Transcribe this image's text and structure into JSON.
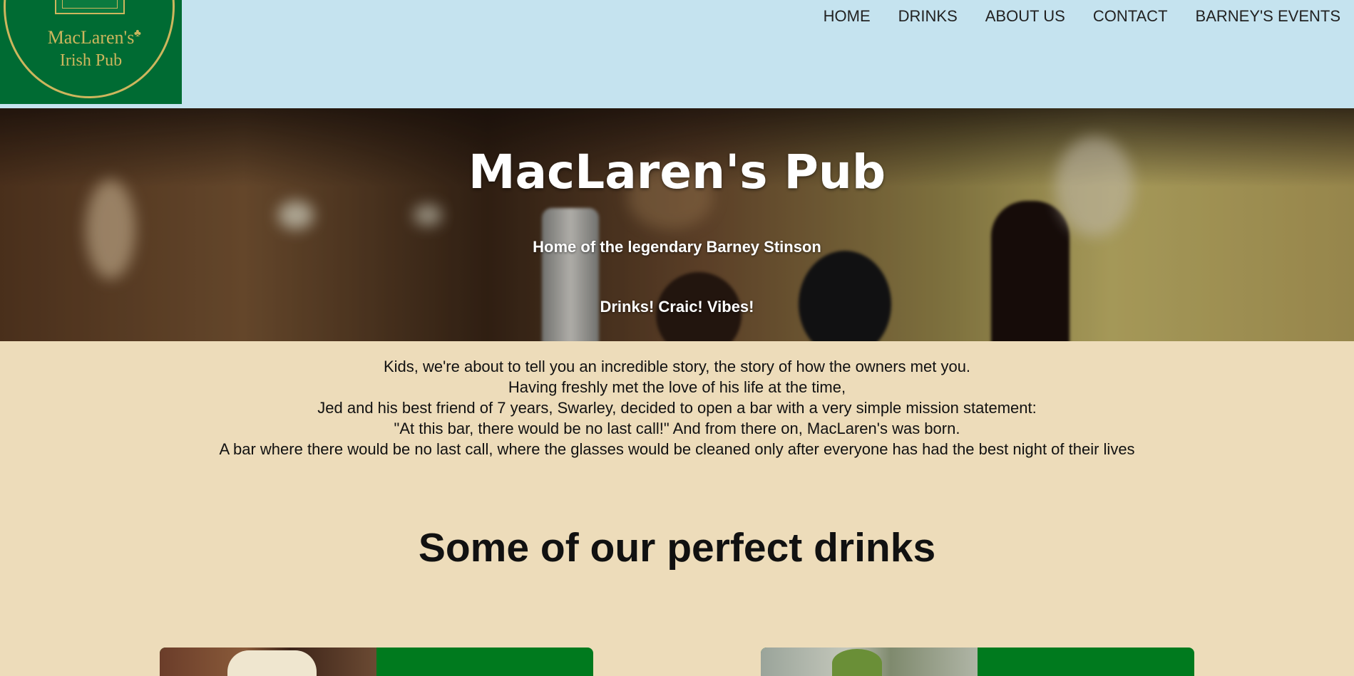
{
  "logo": {
    "line1": "MacLaren's",
    "line2": "Irish Pub"
  },
  "nav": {
    "items": [
      "HOME",
      "DRINKS",
      "ABOUT US",
      "CONTACT",
      "BARNEY'S EVENTS"
    ]
  },
  "hero": {
    "title": "MacLaren's Pub",
    "subtitle1": "Home of the legendary Barney Stinson",
    "subtitle2": "Drinks! Craic! Vibes!"
  },
  "story": {
    "lines": [
      "Kids, we're about to tell you an incredible story, the story of how the owners met you.",
      "Having freshly met the love of his life at the time,",
      "Jed and his best friend of 7 years, Swarley, decided to open a bar with a very simple mission statement:",
      "\"At this bar, there would be no last call!\" And from there on, MacLaren's was born.",
      "A bar where there would be no last call, where the glasses would be cleaned only after everyone has had the best night of their lives"
    ]
  },
  "drinks": {
    "heading": "Some of our perfect drinks"
  },
  "colors": {
    "header_bg": "#c5e3ef",
    "logo_bg": "#006b33",
    "logo_gold": "#cdb65d",
    "page_bg": "#eddcba",
    "card_green": "#007a1e"
  }
}
